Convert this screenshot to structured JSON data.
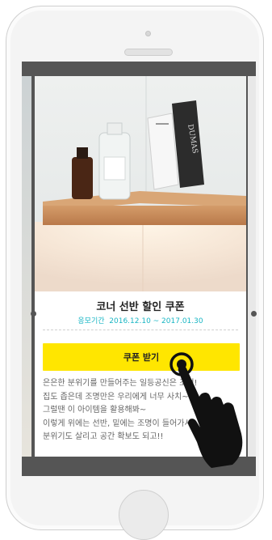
{
  "coupon": {
    "title": "코너 선반 할인 쿠폰",
    "period_label": "응모기간",
    "period_value": "2016.12.10 ~ 2017.01.30",
    "button_label": "쿠폰 받기",
    "description": [
      "은은한 분위기를 만들어주는 일등공신은 조명!",
      "집도 좁은데 조명만은 우리에게 너무 사치~",
      "그럴땐 이 아이템을 활용해봐~",
      "이렇게 위에는 선반, 밑에는 조명이 들어가서",
      "분위기도 살리고 공간 확보도 되고!!"
    ]
  },
  "photo": {
    "book_spine_text": "DUMAS"
  },
  "colors": {
    "accent_yellow": "#ffe600",
    "period_color": "#19b6c4",
    "screen_backdrop": "#555555"
  },
  "icons": {
    "touch_gesture": "hand-tap-icon"
  }
}
